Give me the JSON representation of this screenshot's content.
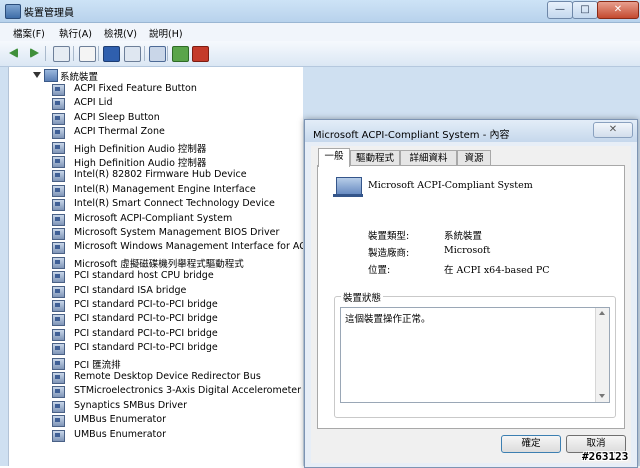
{
  "window": {
    "title": "裝置管理員",
    "minimize_glyph": "—",
    "maximize_glyph": "□",
    "close_glyph": "✕"
  },
  "menu": {
    "items": [
      "檔案(F)",
      "執行(A)",
      "檢視(V)",
      "說明(H)"
    ]
  },
  "toolbar": {
    "icons": [
      "back-arrow-icon",
      "forward-arrow-icon",
      "show-hide-tree-icon",
      "properties-icon",
      "help-icon",
      "view-icon",
      "update-driver-icon",
      "uninstall-icon"
    ]
  },
  "tree": {
    "root_label": "系統裝置",
    "items": [
      "ACPI Fixed Feature Button",
      "ACPI Lid",
      "ACPI Sleep Button",
      "ACPI Thermal Zone",
      "High Definition Audio 控制器",
      "High Definition Audio 控制器",
      "Intel(R) 82802 Firmware Hub Device",
      "Intel(R) Management Engine Interface",
      "Intel(R) Smart Connect Technology Device",
      "Microsoft ACPI-Compliant System",
      "Microsoft System Management BIOS Driver",
      "Microsoft Windows Management Interface for ACPI",
      "Microsoft 虛擬磁碟機列舉程式驅動程式",
      "PCI standard host CPU bridge",
      "PCI standard ISA bridge",
      "PCI standard PCI-to-PCI bridge",
      "PCI standard PCI-to-PCI bridge",
      "PCI standard PCI-to-PCI bridge",
      "PCI standard PCI-to-PCI bridge",
      "PCI 匯流排",
      "Remote Desktop Device Redirector Bus",
      "STMicroelectronics 3-Axis Digital Accelerometer",
      "Synaptics SMBus Driver",
      "UMBus Enumerator",
      "UMBus Enumerator"
    ]
  },
  "dialog": {
    "title": "Microsoft ACPI-Compliant System - 內容",
    "close_glyph": "✕",
    "tabs": [
      "一般",
      "驅動程式",
      "詳細資料",
      "資源"
    ],
    "active_tab": "一般",
    "device_name": "Microsoft ACPI-Compliant System",
    "props": [
      {
        "label": "裝置類型:",
        "value": "系統裝置"
      },
      {
        "label": "製造廠商:",
        "value": "Microsoft"
      },
      {
        "label": "位置:",
        "value": "在 ACPI x64-based PC"
      }
    ],
    "status_label": "裝置狀態",
    "status_text": "這個裝置操作正常。",
    "ok_label": "確定",
    "cancel_label": "取消"
  },
  "watermark": "#263123"
}
